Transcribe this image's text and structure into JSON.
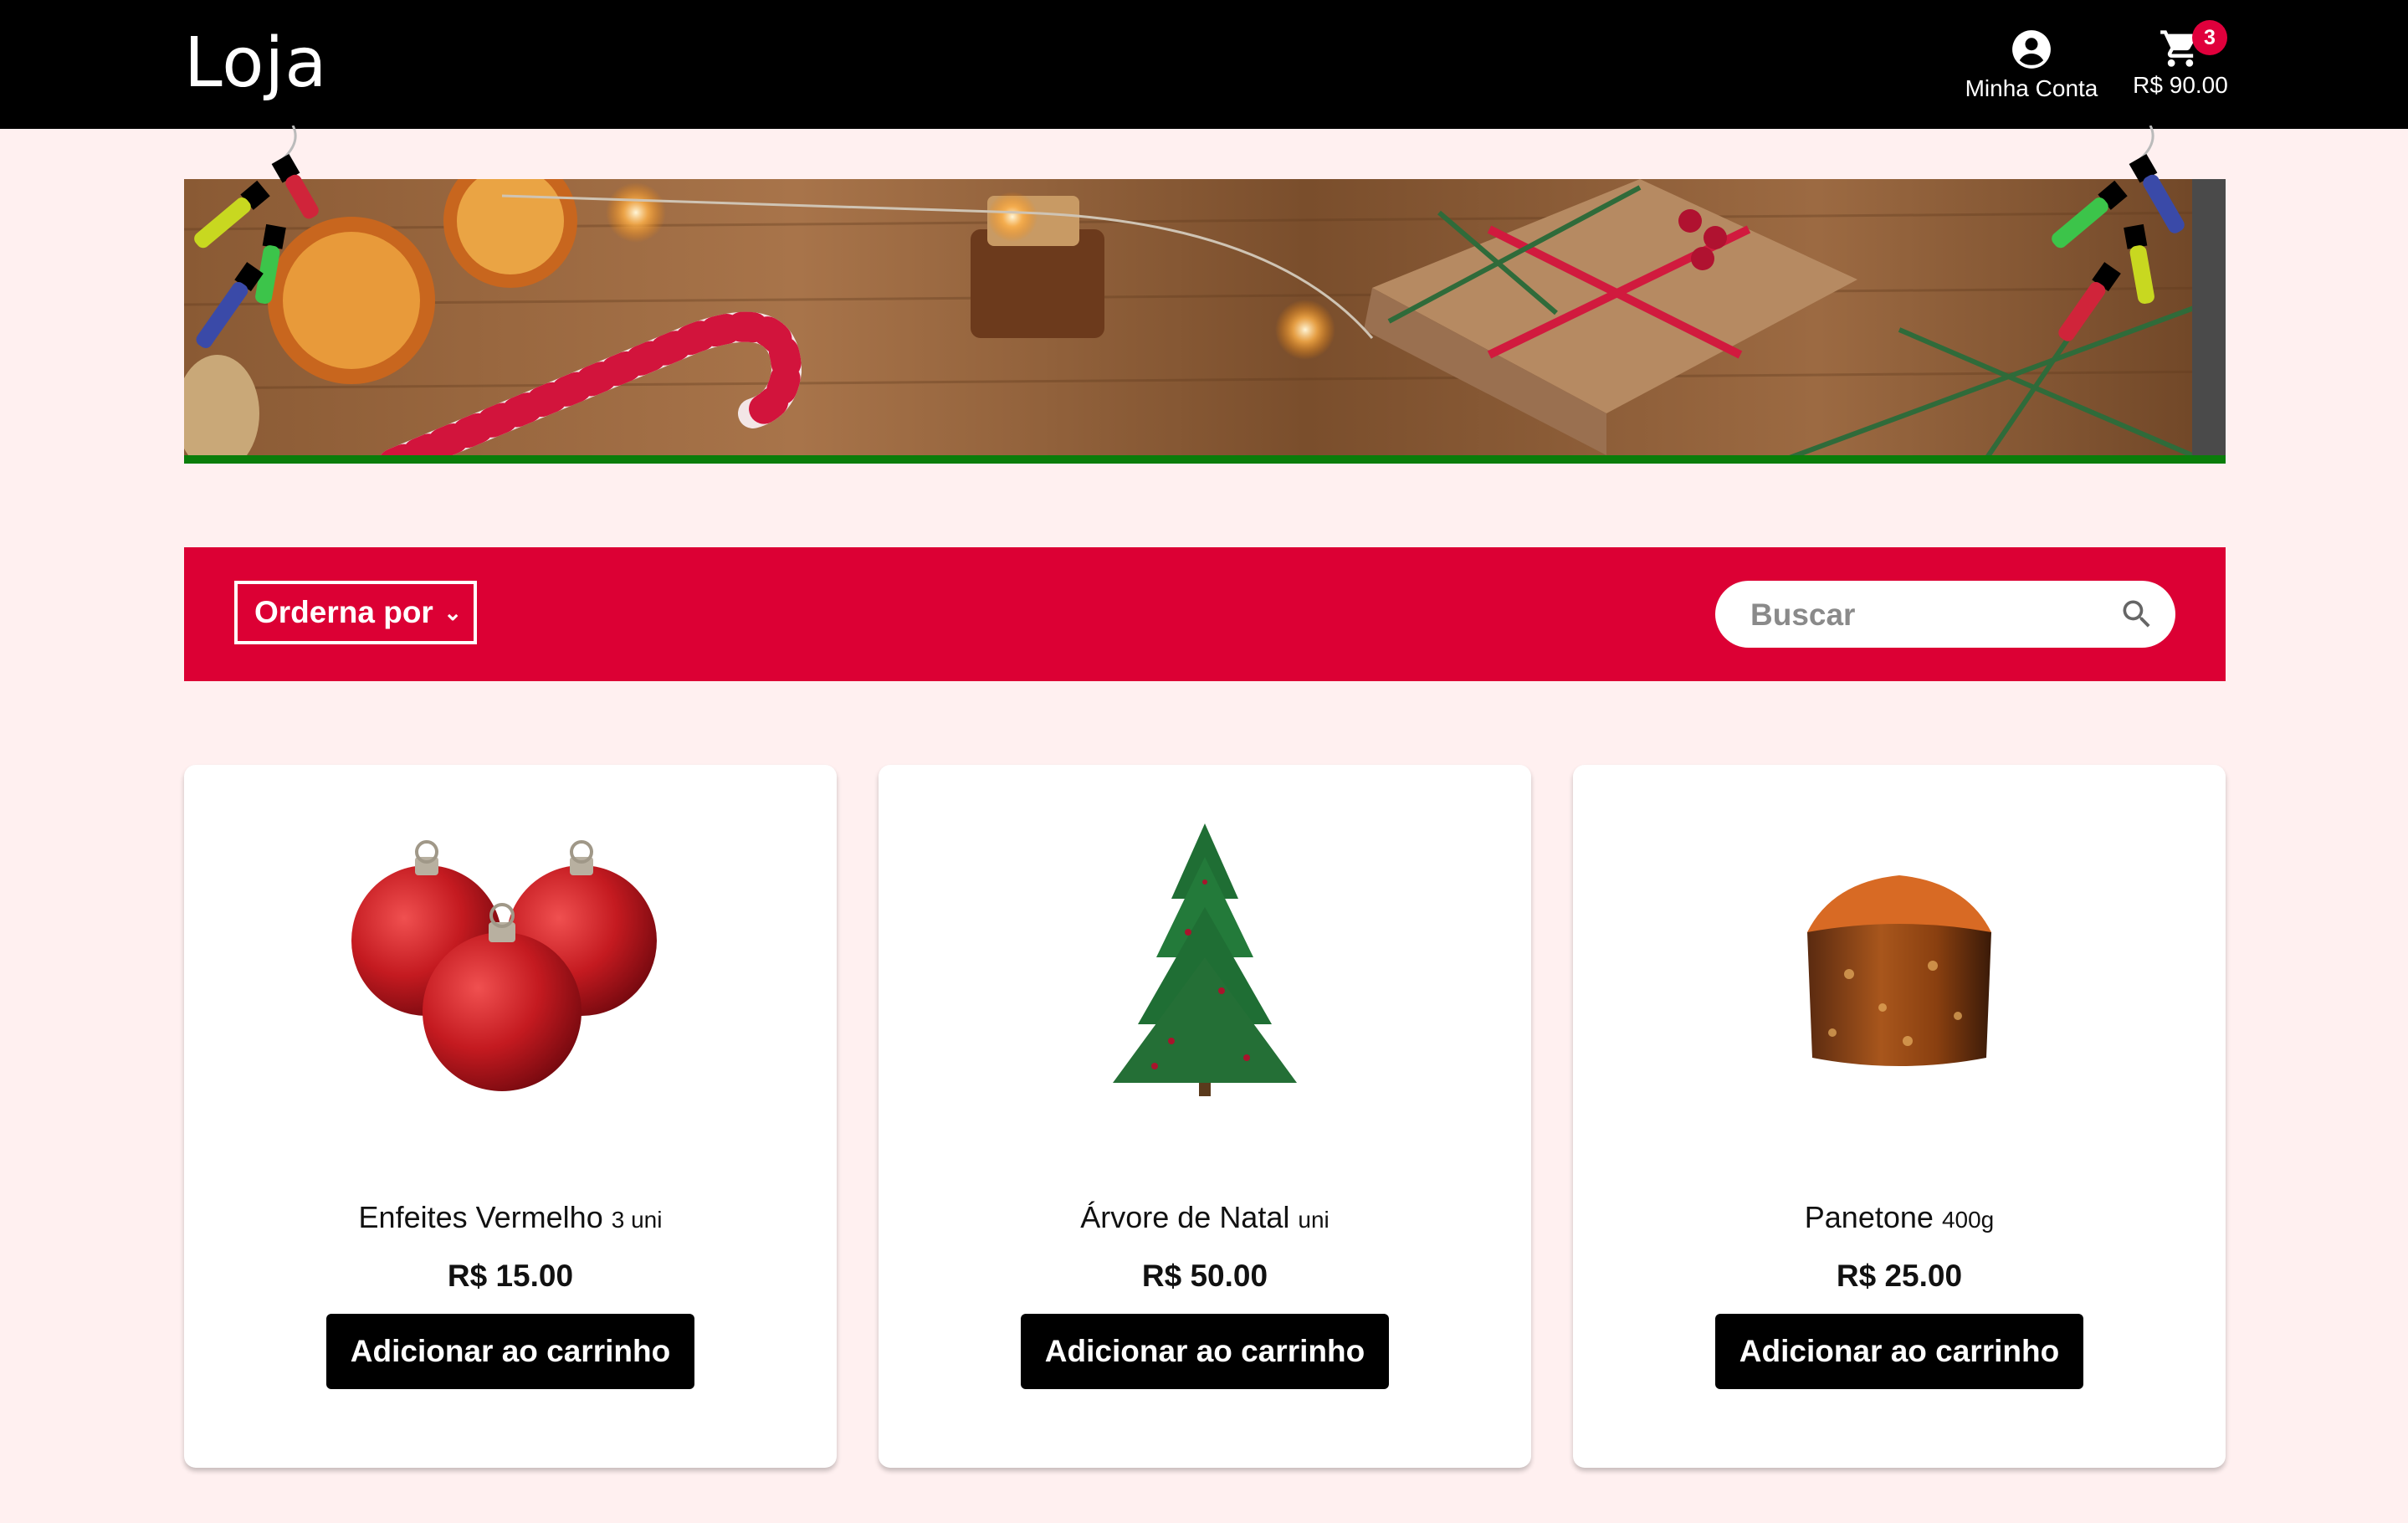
{
  "header": {
    "logo": "Loja",
    "account_label": "Minha Conta",
    "account_icon": "account-circle-icon",
    "cart_icon": "shopping-cart-icon",
    "cart_total": "R$ 90.00",
    "cart_count": "3"
  },
  "filters": {
    "sort_label": "Orderna por",
    "search_placeholder": "Buscar",
    "search_icon": "search-icon"
  },
  "colors": {
    "header_bg": "#000000",
    "page_bg": "#fff0f0",
    "accent_red": "#dc0034",
    "banner_strip": "#0a7d0a",
    "badge": "#e0003c"
  },
  "products": [
    {
      "name": "Enfeites Vermelho",
      "unit": "3 uni",
      "price": "R$ 15.00",
      "button": "Adicionar ao carrinho",
      "image": "red-ornaments"
    },
    {
      "name": "Árvore de Natal",
      "unit": "uni",
      "price": "R$ 50.00",
      "button": "Adicionar ao carrinho",
      "image": "christmas-tree"
    },
    {
      "name": "Panetone",
      "unit": "400g",
      "price": "R$ 25.00",
      "button": "Adicionar ao carrinho",
      "image": "panettone"
    }
  ]
}
